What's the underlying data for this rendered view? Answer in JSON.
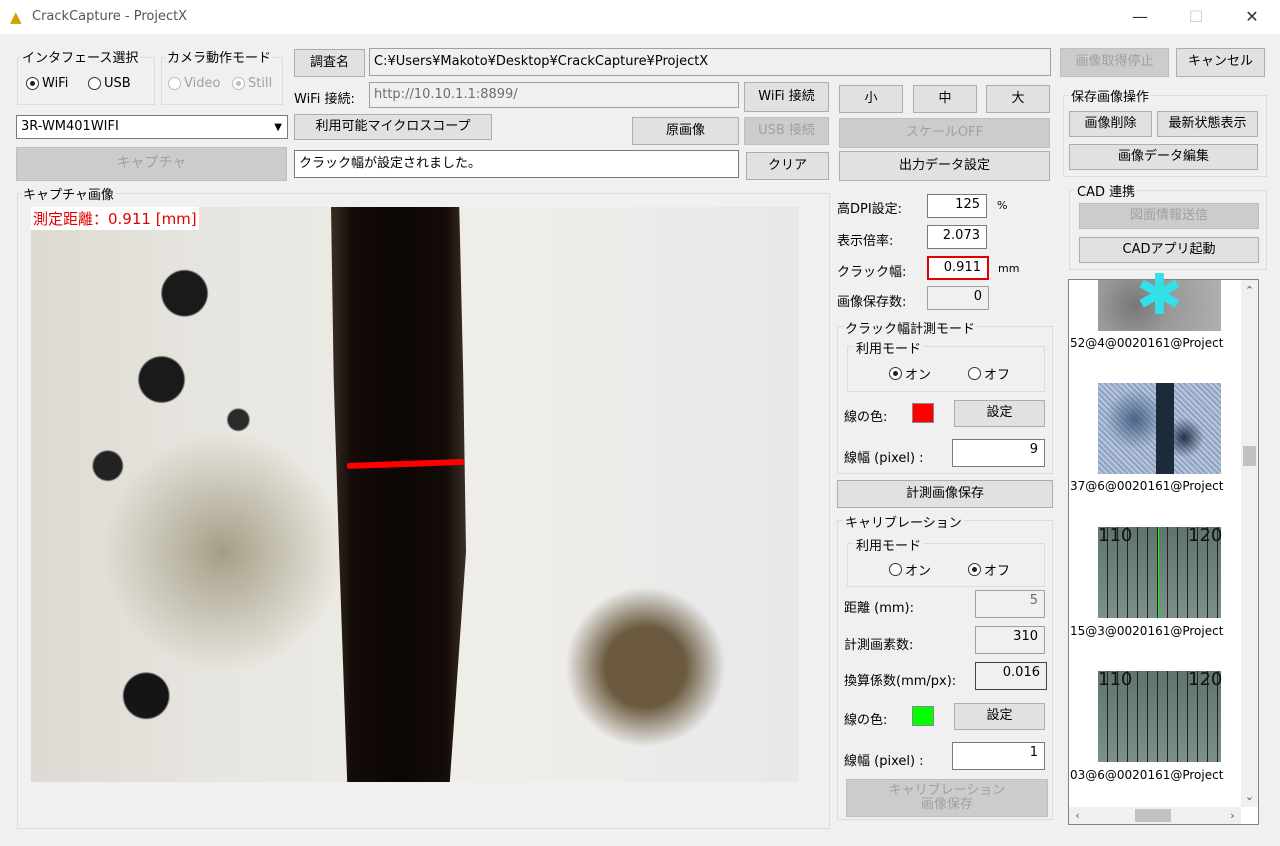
{
  "window": {
    "title": "CrackCapture - ProjectX"
  },
  "interface": {
    "group_label": "インタフェース選択",
    "wifi_label": "WiFi",
    "usb_label": "USB",
    "selected": "WiFi"
  },
  "camera_mode": {
    "group_label": "カメラ動作モード",
    "video_label": "Video",
    "still_label": "Still",
    "selected": "Still"
  },
  "survey": {
    "button_label": "調査名",
    "path": "C:¥Users¥Makoto¥Desktop¥CrackCapture¥ProjectX"
  },
  "wifi": {
    "label": "WiFi 接続:",
    "url": "http://10.10.1.1:8899/",
    "connect_label": "WiFi 接続"
  },
  "usb": {
    "connect_label": "USB 接続"
  },
  "device": {
    "selected": "3R-WM401WIFI",
    "scope_button_label": "利用可能マイクロスコープ"
  },
  "original_button_label": "原画像",
  "capture_button_label": "キャプチャ",
  "status": {
    "message": "クラック幅が設定されました。",
    "clear_label": "クリア"
  },
  "size_buttons": {
    "small": "小",
    "medium": "中",
    "large": "大"
  },
  "scale_off_label": "スケールOFF",
  "output_settings_label": "出力データ設定",
  "stop_capture_label": "画像取得停止",
  "cancel_label": "キャンセル",
  "capture_image": {
    "group_label": "キャプチャ画像",
    "measurement_text": "測定距離：0.911 [mm]"
  },
  "info": {
    "dpi_label": "高DPI設定:",
    "dpi_value": "125",
    "dpi_unit": "%",
    "zoom_label": "表示倍率:",
    "zoom_value": "2.073",
    "crack_label": "クラック幅:",
    "crack_value": "0.911",
    "crack_unit": "mm",
    "saved_label": "画像保存数:",
    "saved_value": "0"
  },
  "crack_mode": {
    "group_label": "クラック幅計測モード",
    "use_mode_label": "利用モード",
    "on_label": "オン",
    "off_label": "オフ",
    "selected": "オン",
    "line_color_label": "線の色:",
    "line_color": "#ff0000",
    "set_label": "設定",
    "line_width_label": "線幅 (pixel) :",
    "line_width_value": "9"
  },
  "save_measure_image_label": "計測画像保存",
  "calibration": {
    "group_label": "キャリブレーション",
    "use_mode_label": "利用モード",
    "on_label": "オン",
    "off_label": "オフ",
    "selected": "オフ",
    "distance_label": "距離 (mm):",
    "distance_value": "5",
    "pixels_label": "計測画素数:",
    "pixels_value": "310",
    "factor_label": "換算係数(mm/px):",
    "factor_value": "0.016",
    "line_color_label": "線の色:",
    "line_color": "#00ff00",
    "set_label": "設定",
    "line_width_label": "線幅 (pixel) :",
    "line_width_value": "1",
    "save_line1": "キャリブレーション",
    "save_line2": "画像保存"
  },
  "saved_images": {
    "group_label": "保存画像操作",
    "delete_label": "画像削除",
    "latest_label": "最新状態表示",
    "edit_label": "画像データ編集"
  },
  "cad": {
    "group_label": "CAD 連携",
    "send_label": "図面情報送信",
    "launch_label": "CADアプリ起動"
  },
  "thumbnails": [
    {
      "caption": "52@4@0020161@Project"
    },
    {
      "caption": "37@6@0020161@Project"
    },
    {
      "caption": "15@3@0020161@Project",
      "label_a": "110",
      "label_b": "120"
    },
    {
      "caption": "03@6@0020161@Project",
      "label_a": "110",
      "label_b": "120"
    }
  ]
}
